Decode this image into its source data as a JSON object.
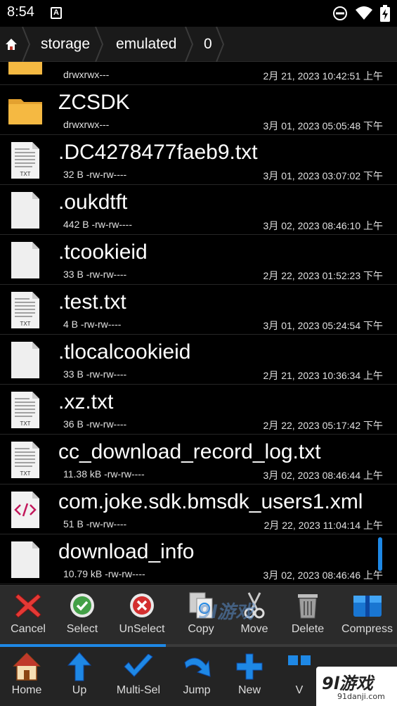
{
  "status_bar": {
    "time": "8:54",
    "notification_letter": "A",
    "icons": [
      "do-not-disturb-icon",
      "wifi-icon",
      "battery-charging-icon"
    ]
  },
  "breadcrumb": {
    "home_icon": "home-icon",
    "items": [
      "storage",
      "emulated",
      "0"
    ]
  },
  "files": [
    {
      "name": "",
      "meta": "drwxrwx---",
      "date": "2月 21, 2023 10:42:51 上午",
      "type": "folder"
    },
    {
      "name": "ZCSDK",
      "meta": "drwxrwx---",
      "date": "3月 01, 2023 05:05:48 下午",
      "type": "folder"
    },
    {
      "name": ".DC4278477faeb9.txt",
      "meta": "32 B -rw-rw----",
      "date": "3月 01, 2023 03:07:02 下午",
      "type": "txt"
    },
    {
      "name": ".oukdtft",
      "meta": "442 B -rw-rw----",
      "date": "3月 02, 2023 08:46:10 上午",
      "type": "blank"
    },
    {
      "name": ".tcookieid",
      "meta": "33 B -rw-rw----",
      "date": "2月 22, 2023 01:52:23 下午",
      "type": "blank"
    },
    {
      "name": ".test.txt",
      "meta": "4 B -rw-rw----",
      "date": "3月 01, 2023 05:24:54 下午",
      "type": "txt"
    },
    {
      "name": ".tlocalcookieid",
      "meta": "33 B -rw-rw----",
      "date": "2月 21, 2023 10:36:34 上午",
      "type": "blank"
    },
    {
      "name": ".xz.txt",
      "meta": "36 B -rw-rw----",
      "date": "2月 22, 2023 05:17:42 下午",
      "type": "txt"
    },
    {
      "name": "cc_download_record_log.txt",
      "meta": "11.38 kB -rw-rw----",
      "date": "3月 02, 2023 08:46:44 上午",
      "type": "txt"
    },
    {
      "name": "com.joke.sdk.bmsdk_users1.xml",
      "meta": "51 B -rw-rw----",
      "date": "2月 22, 2023 11:04:14 上午",
      "type": "xml"
    },
    {
      "name": "download_info",
      "meta": "10.79 kB -rw-rw----",
      "date": "3月 02, 2023 08:46:46 上午",
      "type": "blank"
    }
  ],
  "file_icon_labels": {
    "txt": "TXT"
  },
  "actions": [
    "Cancel",
    "Select",
    "UnSelect",
    "Copy",
    "Move",
    "Delete",
    "Compress"
  ],
  "nav": [
    "Home",
    "Up",
    "Multi-Sel",
    "Jump",
    "New",
    "V"
  ],
  "watermark": {
    "text": "9l游戏",
    "url": "91danji.com",
    "mid_text": "9l游戏"
  },
  "colors": {
    "accent": "#1e88e5",
    "folder": "#f5b942",
    "cancel_red": "#e53935",
    "select_green": "#43a047"
  }
}
